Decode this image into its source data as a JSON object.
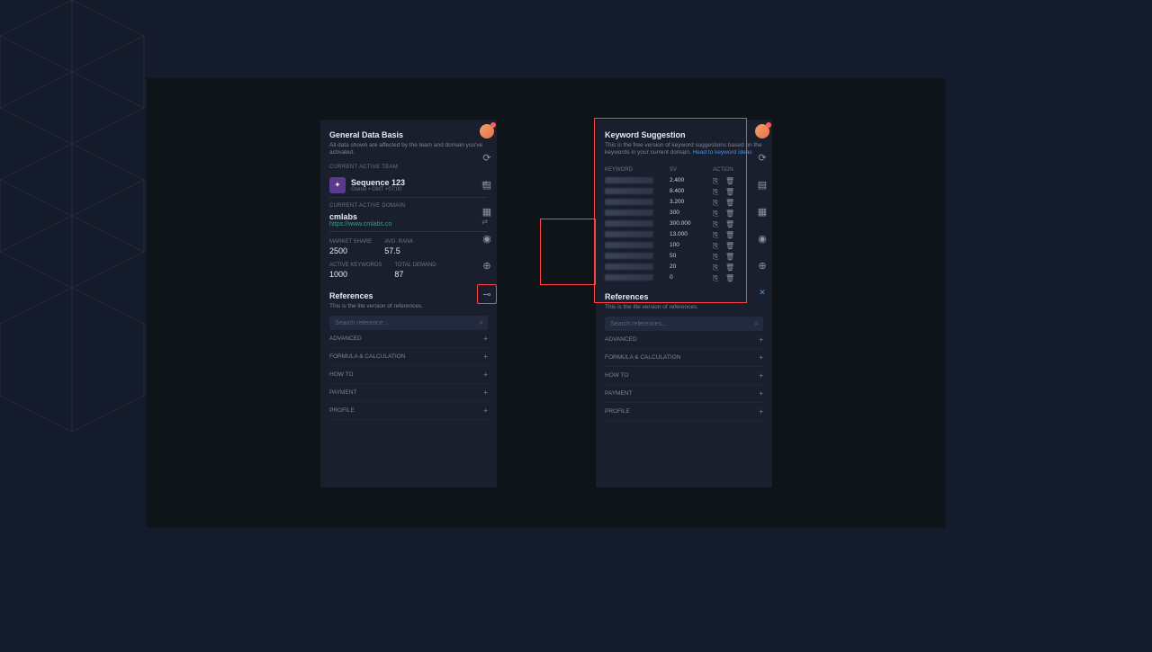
{
  "left_panel": {
    "title": "General Data Basis",
    "subtitle": "All data shown are affected by the team and domain you've activated.",
    "team_label": "CURRENT ACTIVE TEAM",
    "team_name": "Sequence 123",
    "team_meta": "Owner • GMT +07:00",
    "domain_label": "CURRENT ACTIVE DOMAIN",
    "domain_name": "cmlabs",
    "domain_url": "https://www.cmlabs.co",
    "stats": {
      "market_share_label": "MARKET SHARE",
      "market_share": "2500",
      "avg_rank_label": "AVG. RANK",
      "avg_rank": "57.5",
      "active_kw_label": "ACTIVE KEYWORDS",
      "active_kw": "1000",
      "total_demand_label": "TOTAL DEMAND",
      "total_demand": "87"
    },
    "references": {
      "title": "References",
      "subtitle": "This is the lite version of references.",
      "search_placeholder": "Search reference...",
      "items": [
        "ADVANCED",
        "FORMULA & CALCULATION",
        "HOW TO",
        "PAYMENT",
        "PROFILE"
      ]
    }
  },
  "right_panel": {
    "title": "Keyword Suggestion",
    "subtitle_text": "This is the free version of keyword suggestions based on the keywords in your current domain.",
    "subtitle_link": "Head to keyword ideas",
    "table": {
      "headers": {
        "keyword": "KEYWORD",
        "sv": "SV",
        "action": "ACTION"
      },
      "rows": [
        {
          "sv": "2.400"
        },
        {
          "sv": "8.400"
        },
        {
          "sv": "3.200"
        },
        {
          "sv": "300"
        },
        {
          "sv": "300.000"
        },
        {
          "sv": "13.000"
        },
        {
          "sv": "100"
        },
        {
          "sv": "50"
        },
        {
          "sv": "20"
        },
        {
          "sv": "0"
        }
      ]
    },
    "references": {
      "title": "References",
      "subtitle": "This is the lite version of references.",
      "search_placeholder": "Search references...",
      "items": [
        "ADVANCED",
        "FORMULA & CALCULATION",
        "HOW TO",
        "PAYMENT",
        "PROFILE"
      ]
    }
  }
}
